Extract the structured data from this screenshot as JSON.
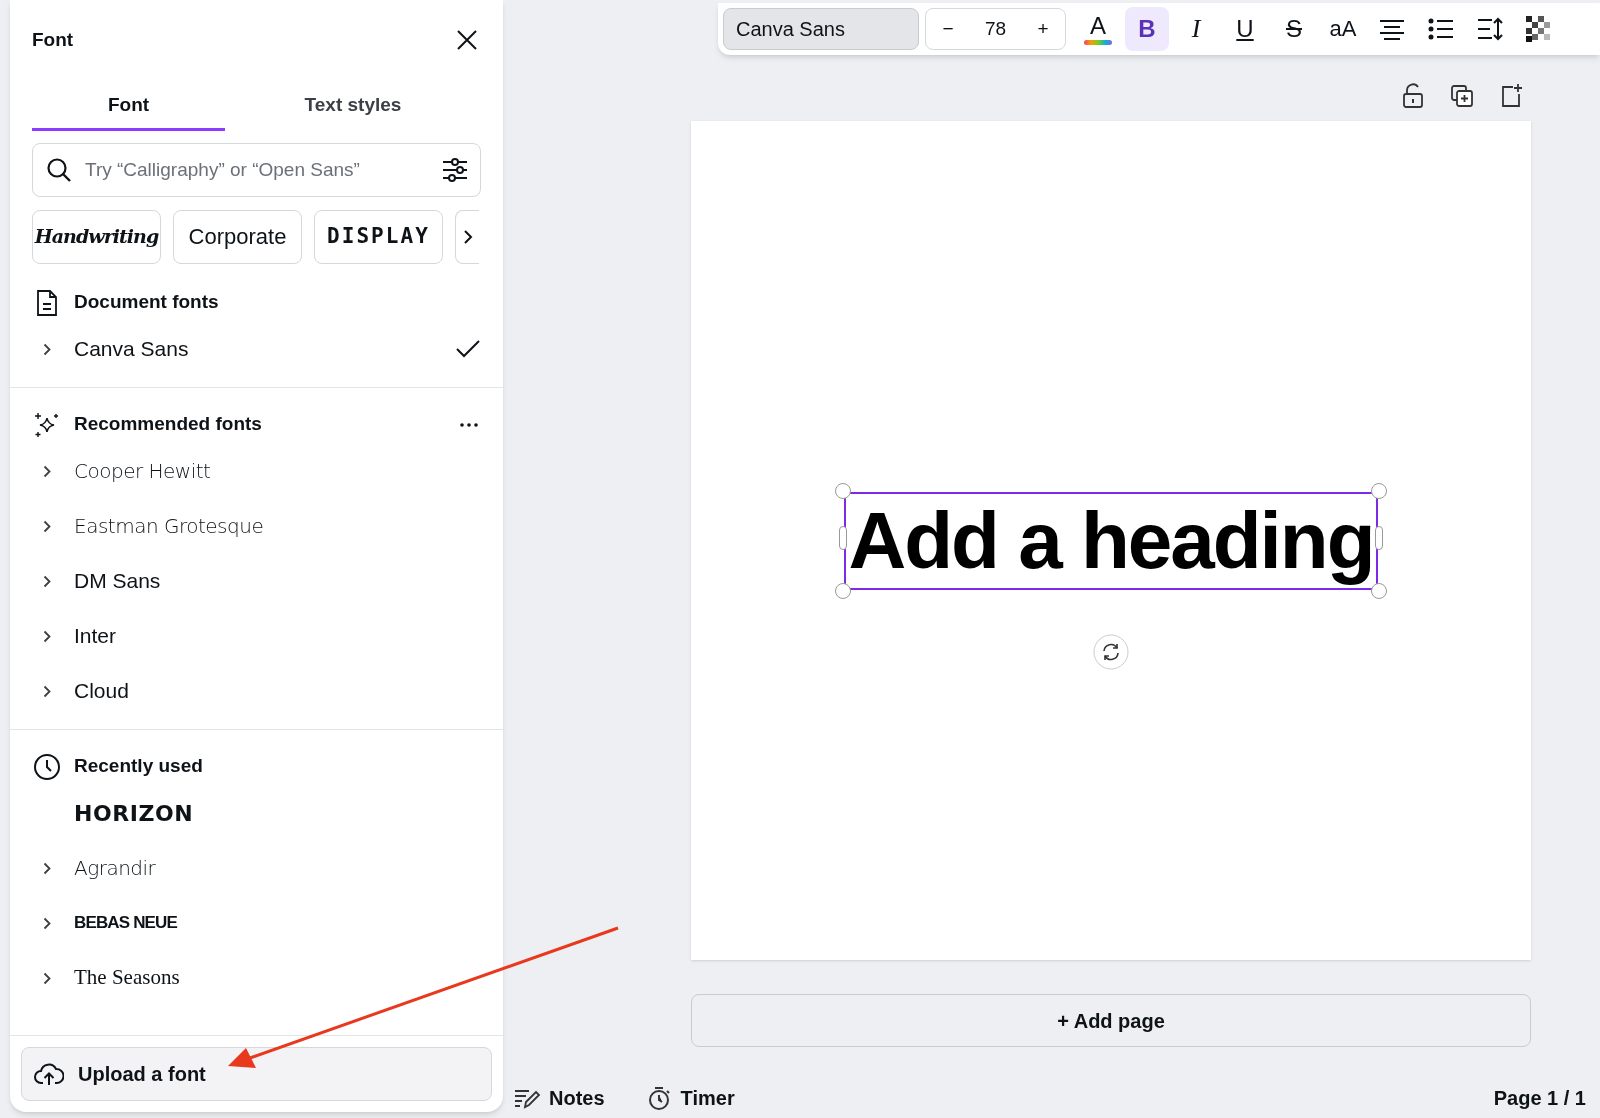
{
  "panel": {
    "title": "Font",
    "tabs": [
      {
        "label": "Font",
        "selected": true
      },
      {
        "label": "Text styles",
        "selected": false
      }
    ],
    "search": {
      "placeholder": "Try “Calligraphy” or “Open Sans”"
    },
    "chips": [
      {
        "label": "Handwriting",
        "kind": "script"
      },
      {
        "label": "Corporate",
        "kind": "plain"
      },
      {
        "label": "DISPLAY",
        "kind": "display"
      }
    ],
    "sections": [
      {
        "kind": "document",
        "title": "Document fonts",
        "items": [
          {
            "name": "Canva Sans",
            "kind": "sans",
            "expandable": true,
            "selected": true
          }
        ]
      },
      {
        "kind": "recommended",
        "title": "Recommended fonts",
        "items": [
          {
            "name": "Cooper Hewitt",
            "kind": "light",
            "expandable": true,
            "selected": false
          },
          {
            "name": "Eastman Grotesque",
            "kind": "light",
            "expandable": true,
            "selected": false
          },
          {
            "name": "DM Sans",
            "kind": "sans",
            "expandable": true,
            "selected": false
          },
          {
            "name": "Inter",
            "kind": "sans",
            "expandable": true,
            "selected": false
          },
          {
            "name": "Cloud",
            "kind": "sans",
            "expandable": true,
            "selected": false
          }
        ]
      },
      {
        "kind": "recent",
        "title": "Recently used",
        "items": [
          {
            "name": "HORIZON",
            "kind": "heavy",
            "expandable": false,
            "selected": false
          },
          {
            "name": "Agrandir",
            "kind": "light",
            "expandable": true,
            "selected": false
          },
          {
            "name": "BEBAS NEUE",
            "kind": "condensed",
            "expandable": true,
            "selected": false
          },
          {
            "name": "The Seasons",
            "kind": "serif",
            "expandable": true,
            "selected": false
          }
        ]
      }
    ],
    "upload_button": "Upload a font"
  },
  "toolbar": {
    "font": "Canva Sans",
    "decrease": "−",
    "size": "78",
    "increase": "+",
    "buttons": [
      {
        "kind": "color",
        "glyph": "A",
        "selected": false
      },
      {
        "kind": "bold",
        "glyph": "B",
        "selected": true
      },
      {
        "kind": "italic",
        "glyph": "I",
        "selected": false
      },
      {
        "kind": "underline",
        "glyph": "U",
        "selected": false
      },
      {
        "kind": "strike",
        "glyph": "S",
        "selected": false
      },
      {
        "kind": "case",
        "glyph": "aA",
        "selected": false
      },
      {
        "kind": "align",
        "selected": false
      },
      {
        "kind": "list",
        "selected": false
      },
      {
        "kind": "spacing",
        "selected": false
      },
      {
        "kind": "transparency",
        "selected": false
      }
    ]
  },
  "canvas": {
    "heading": "Add a heading",
    "add_page": "+ Add page"
  },
  "footer": {
    "notes": "Notes",
    "timer": "Timer",
    "page": "Page 1 / 1"
  }
}
